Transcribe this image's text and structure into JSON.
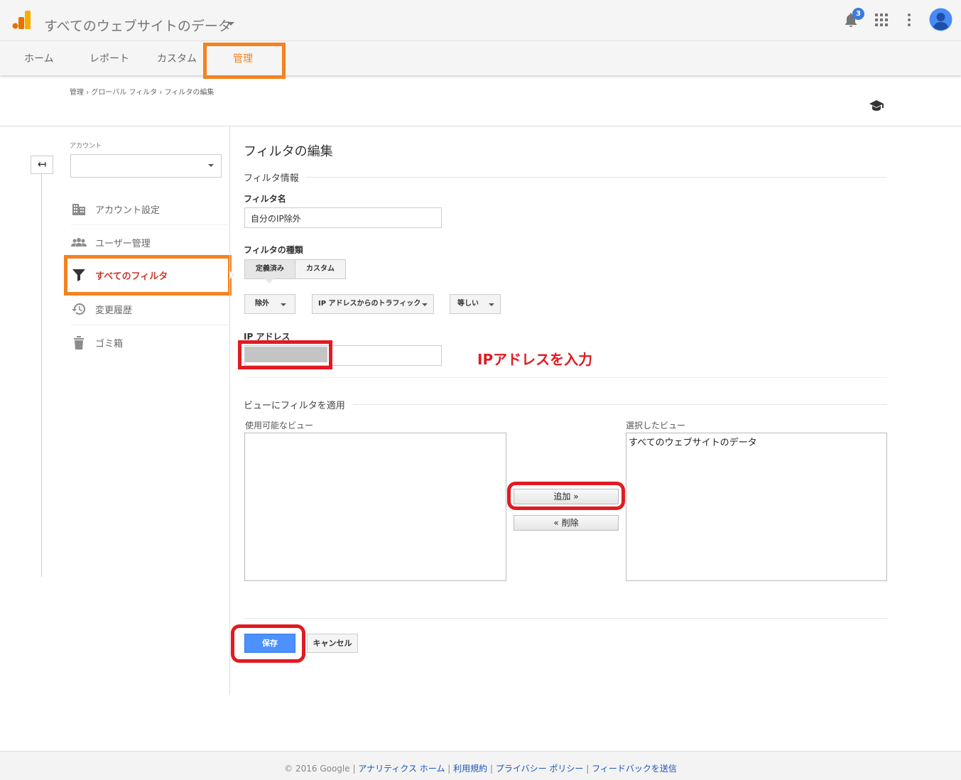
{
  "header": {
    "title": "すべてのウェブサイトのデータ",
    "notification_count": "3",
    "logo_icon": "analytics-logo-icon",
    "icons": [
      "bell-icon",
      "apps-grid-icon",
      "more-vert-icon",
      "account-avatar-icon"
    ],
    "colors": {
      "logo_primary": "#f9ab00",
      "logo_secondary": "#e37400",
      "badge": "#3d7bdc",
      "avatar": "#4a8af4"
    }
  },
  "nav": {
    "tabs": [
      {
        "label": "ホーム"
      },
      {
        "label": "レポート"
      },
      {
        "label": "カスタム"
      },
      {
        "label": "管理"
      }
    ],
    "active_color": "#f58220"
  },
  "breadcrumb": "管理 › グローバル フィルタ › フィルタの編集",
  "sidebar": {
    "account_label": "アカウント",
    "account_value": "",
    "items": [
      {
        "label": "アカウント設定",
        "icon": "building-icon"
      },
      {
        "label": "ユーザー管理",
        "icon": "people-icon"
      },
      {
        "label": "すべてのフィルタ",
        "icon": "filter-icon"
      },
      {
        "label": "変更履歴",
        "icon": "history-icon"
      },
      {
        "label": "ゴミ箱",
        "icon": "trash-icon"
      }
    ],
    "active_color": "#c53929"
  },
  "main": {
    "heading": "フィルタの編集",
    "filter_info_title": "フィルタ情報",
    "filter_name_label": "フィルタ名",
    "filter_name_value": "自分のIP除外",
    "filter_type_label": "フィルタの種類",
    "type_tabs": [
      "定義済み",
      "カスタム"
    ],
    "dropdowns": [
      "除外",
      "IP アドレスからのトラフィック",
      "等しい"
    ],
    "ip_label": "IP アドレス",
    "ip_value": "",
    "ip_annotation": "IPアドレスを入力",
    "apply_section_title": "ビューにフィルタを適用",
    "available_label": "使用可能なビュー",
    "selected_label": "選択したビュー",
    "available_views": [],
    "selected_views": [
      "すべてのウェブサイトのデータ"
    ],
    "add_button": "追加 »",
    "remove_button": "« 削除",
    "save_button": "保存",
    "cancel_button": "キャンセル",
    "colors": {
      "save_button": "#4d90fe",
      "annotation_red": "#e21a22",
      "annotation_orange": "#f58220"
    }
  },
  "footer": {
    "copyright": "© 2016 Google",
    "links": [
      "アナリティクス ホーム",
      "利用規約",
      "プライバシー ポリシー",
      "フィードバックを送信"
    ]
  }
}
